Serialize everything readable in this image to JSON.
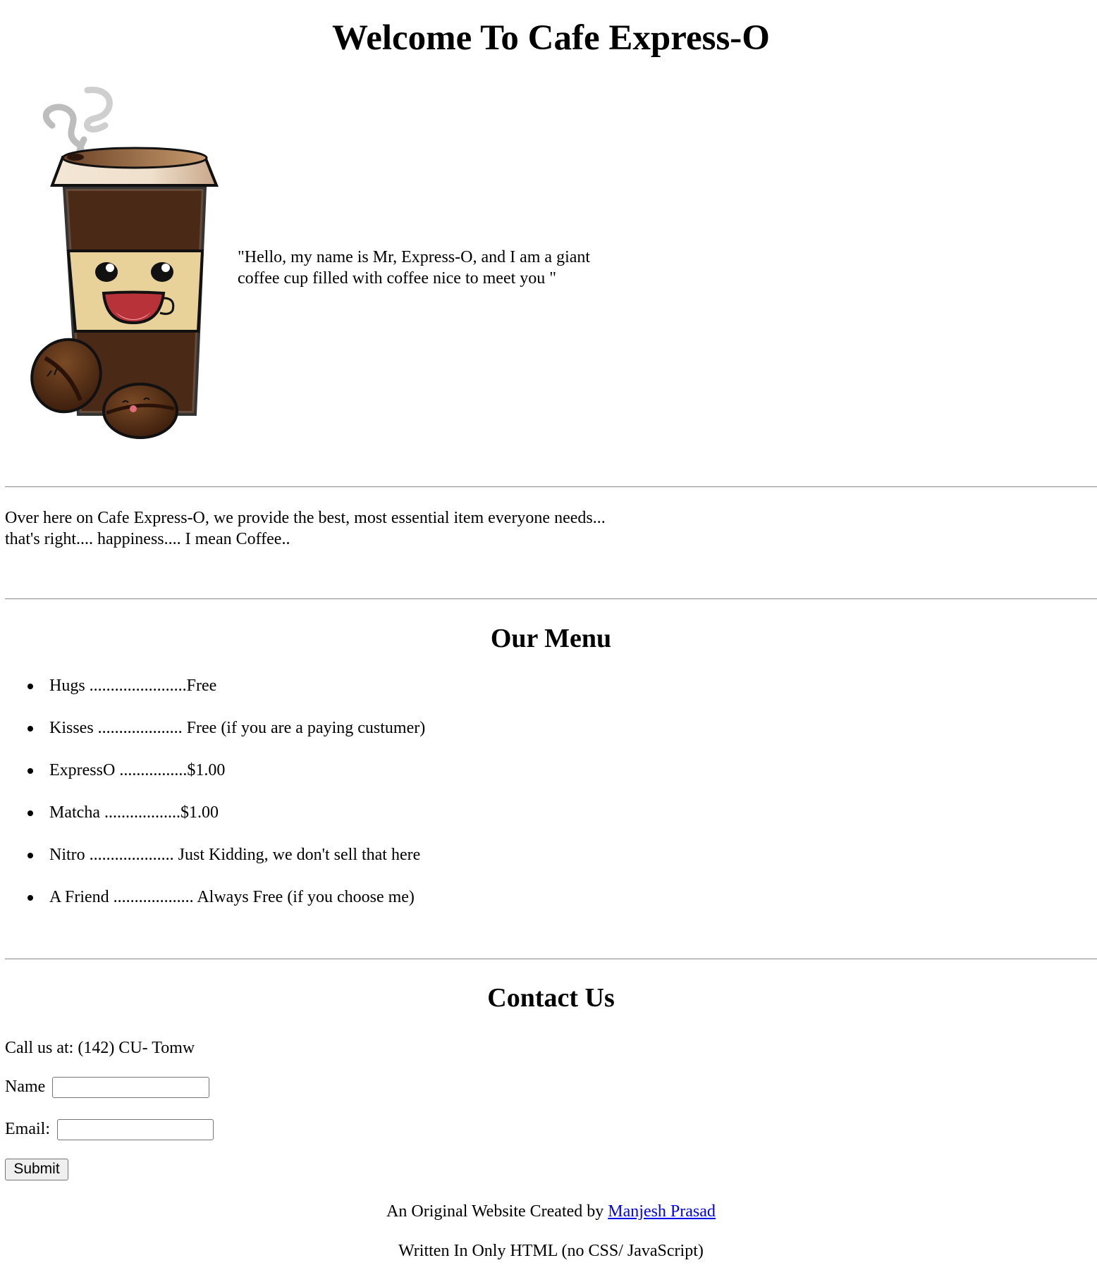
{
  "header": {
    "title": "Welcome To Cafe Express-O"
  },
  "hero": {
    "image_icon": "coffee-cup-mascot-icon",
    "quote_line1": "\"Hello, my name is Mr, Express-O, and I am a giant",
    "quote_line2": "coffee cup filled with coffee nice to meet you \""
  },
  "intro": {
    "line1": "Over here on Cafe Express-O, we provide the best, most essential item everyone needs...",
    "line2": "that's right.... happiness.... I mean Coffee.."
  },
  "menu": {
    "heading": "Our Menu",
    "items": [
      "Hugs .......................Free",
      "Kisses .................... Free (if you are a paying custumer)",
      "ExpressO ................$1.00",
      "Matcha ..................$1.00",
      "Nitro .................... Just Kidding, we don't sell that here",
      "A Friend ................... Always Free (if you choose me)"
    ]
  },
  "contact": {
    "heading": "Contact Us",
    "phone_line": "Call us at: (142) CU- Tomw",
    "name_label": "Name",
    "name_value": "",
    "email_label": "Email:",
    "email_value": "",
    "submit_label": "Submit"
  },
  "footer": {
    "credit_prefix": "An Original Website Created by ",
    "author_link": "Manjesh Prasad",
    "note": "Written In Only HTML (no CSS/ JavaScript)"
  },
  "colors": {
    "link": "#0000ee",
    "rule": "#9a9a9a",
    "cup_brown": "#4a2a17",
    "sleeve": "#e9d29a"
  }
}
